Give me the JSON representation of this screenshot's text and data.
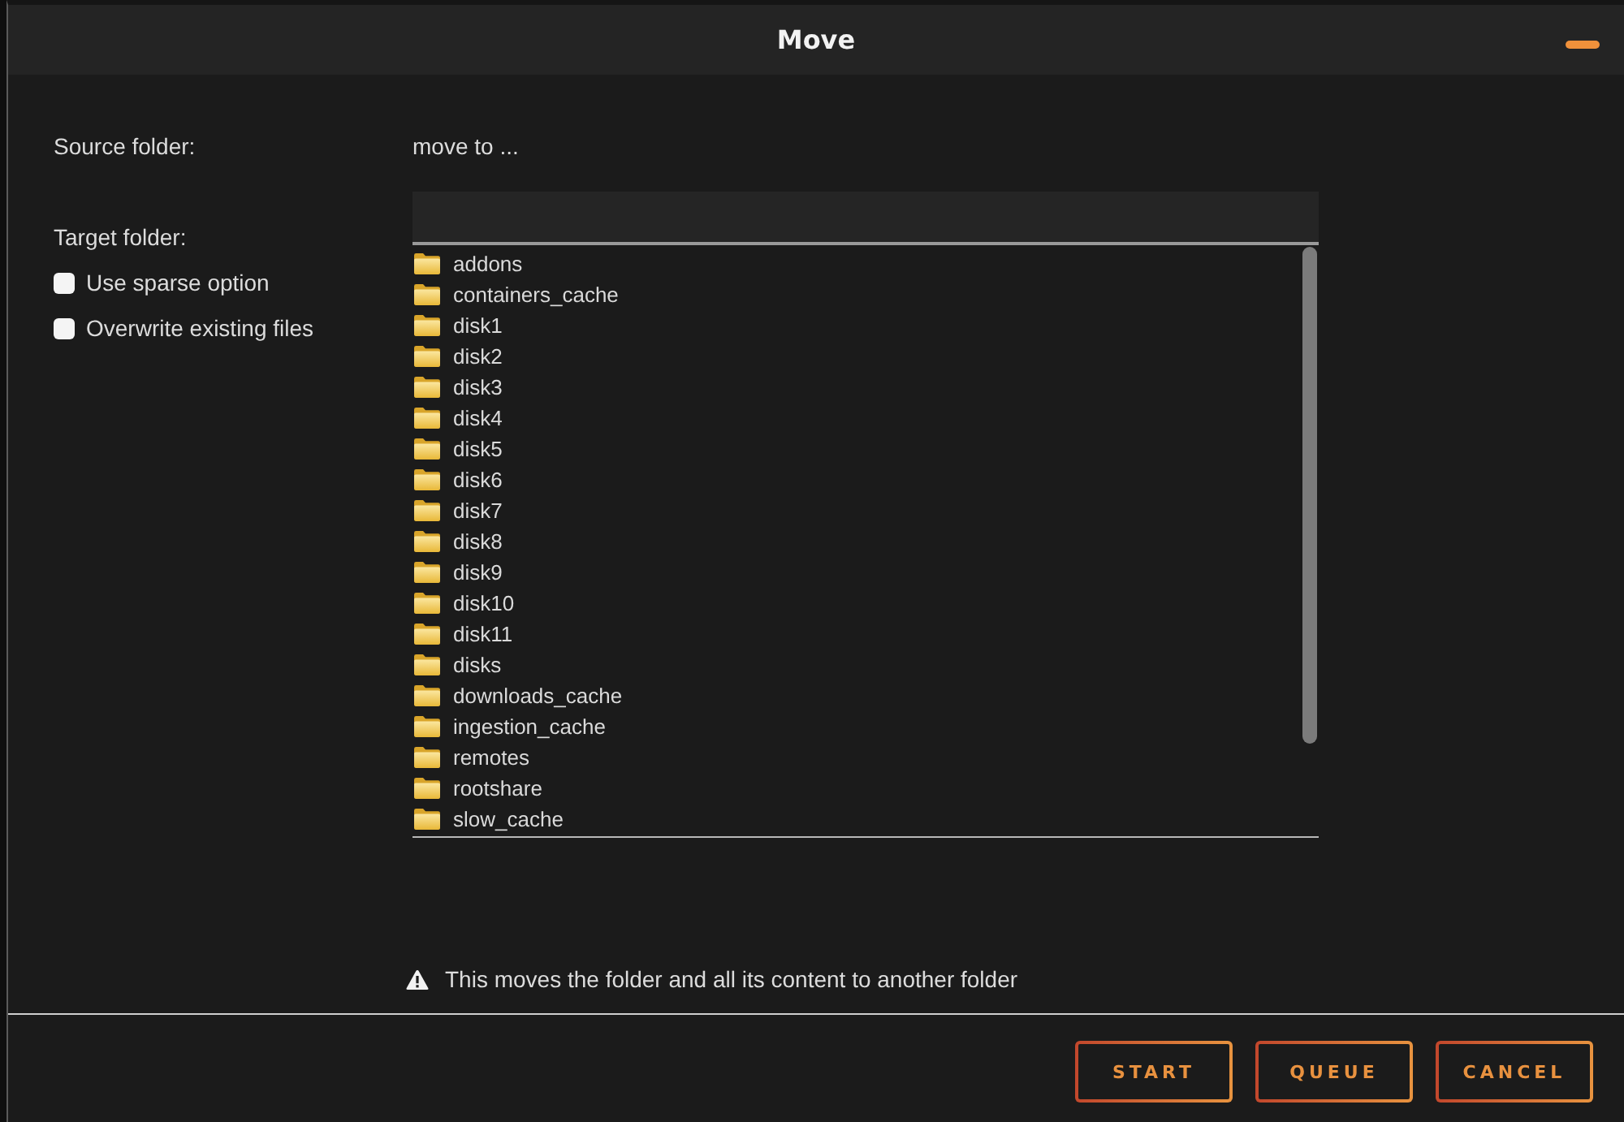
{
  "window": {
    "title": "Move"
  },
  "source": {
    "label": "Source folder:",
    "value": "move to ..."
  },
  "target": {
    "label": "Target folder:"
  },
  "options": [
    {
      "label": "Use sparse option",
      "checked": false
    },
    {
      "label": "Overwrite existing files",
      "checked": false
    }
  ],
  "folders": [
    "addons",
    "containers_cache",
    "disk1",
    "disk2",
    "disk3",
    "disk4",
    "disk5",
    "disk6",
    "disk7",
    "disk8",
    "disk9",
    "disk10",
    "disk11",
    "disks",
    "downloads_cache",
    "ingestion_cache",
    "remotes",
    "rootshare",
    "slow_cache"
  ],
  "warning": "This moves the folder and all its content to another folder",
  "buttons": [
    "START",
    "QUEUE",
    "CANCEL"
  ]
}
